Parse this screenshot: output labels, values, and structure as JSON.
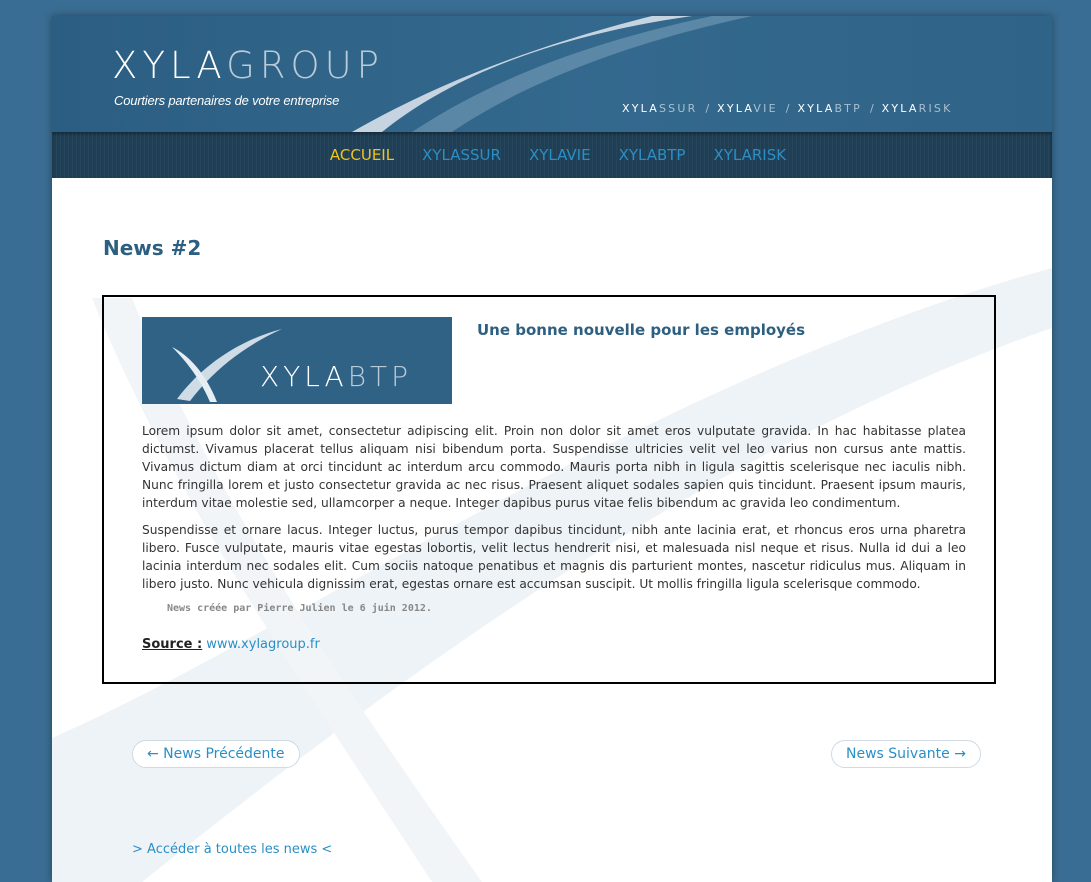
{
  "header": {
    "logo_bold": "XYLA",
    "logo_light": "GROUP",
    "tagline": "Courtiers partenaires de votre entreprise",
    "brand_links": [
      {
        "bold": "XYLA",
        "light": "SSUR"
      },
      {
        "bold": "XYLA",
        "light": "VIE"
      },
      {
        "bold": "XYLA",
        "light": "BTP"
      },
      {
        "bold": "XYLA",
        "light": "RISK"
      }
    ],
    "separator": "/"
  },
  "nav": {
    "items": [
      {
        "label": "ACCUEIL",
        "active": true
      },
      {
        "label": "XYLASSUR",
        "active": false
      },
      {
        "label": "XYLAVIE",
        "active": false
      },
      {
        "label": "XYLABTP",
        "active": false
      },
      {
        "label": "XYLARISK",
        "active": false
      }
    ]
  },
  "main": {
    "page_title": "News #2",
    "article": {
      "image_text_bold": "XYLA",
      "image_text_light": "BTP",
      "title": "Une bonne nouvelle pour les employés",
      "paragraphs": [
        "Lorem ipsum dolor sit amet, consectetur adipiscing elit. Proin non dolor sit amet eros vulputate gravida. In hac habitasse platea dictumst. Vivamus placerat tellus aliquam nisi bibendum porta. Suspendisse ultricies velit vel leo varius non cursus ante mattis. Vivamus dictum diam at orci tincidunt ac interdum arcu commodo. Mauris porta nibh in ligula sagittis scelerisque nec iaculis nibh. Nunc fringilla lorem et justo consectetur gravida ac nec risus. Praesent aliquet sodales sapien quis tincidunt. Praesent ipsum mauris, interdum vitae molestie sed, ullamcorper a neque. Integer dapibus purus vitae felis bibendum ac gravida leo condimentum.",
        "Suspendisse et ornare lacus. Integer luctus, purus tempor dapibus tincidunt, nibh ante lacinia erat, et rhoncus eros urna pharetra libero. Fusce vulputate, mauris vitae egestas lobortis, velit lectus hendrerit nisi, et malesuada nisl neque et risus. Nulla id dui a leo lacinia interdum nec sodales elit. Cum sociis natoque penatibus et magnis dis parturient montes, nascetur ridiculus mus. Aliquam in libero justo. Nunc vehicula dignissim erat, egestas ornare est accumsan suscipit. Ut mollis fringilla ligula scelerisque commodo."
      ],
      "meta": "News créée par Pierre Julien le 6 juin 2012.",
      "source_label": "Source :",
      "source_link": "www.xylagroup.fr"
    },
    "prev_label": "← News Précédente",
    "next_label": "News Suivante →",
    "all_news_label": "> Accéder à toutes les news <"
  },
  "colors": {
    "background": "#3a6d93",
    "header": "#2f6387",
    "nav": "#1e3f55",
    "nav_active": "#f2c318",
    "link": "#2a8fc7",
    "title": "#2d5f80"
  }
}
